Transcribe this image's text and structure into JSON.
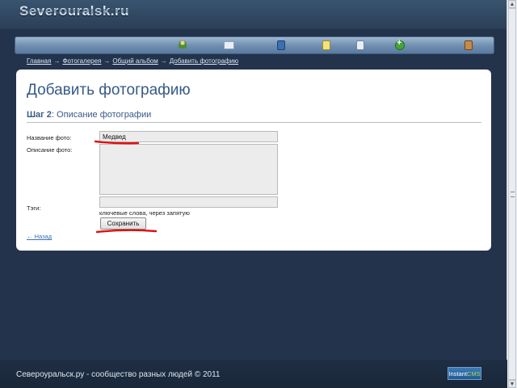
{
  "site": {
    "logo": "Severouralsk.ru"
  },
  "menu": {
    "icons": [
      "user-icon",
      "mail-icon",
      "book-icon",
      "document-icon",
      "copy-icon",
      "add-icon",
      "profile-icon"
    ]
  },
  "breadcrumb": {
    "items": [
      "Главная",
      "Фотогалерея",
      "Общий альбом",
      "Добавить фотографию"
    ],
    "separator": "→"
  },
  "page": {
    "title": "Добавить фотографию",
    "step_label": "Шаг 2",
    "step_text": ": Описание фотографии"
  },
  "form": {
    "name_label": "Название фото:",
    "name_value": "Медвед",
    "description_label": "Описание фото:",
    "description_value": "",
    "tags_label": "Тэги:",
    "tags_value": "",
    "tags_hint": "ключевые слова, через запятую",
    "save_button": "Сохранить",
    "back_link": "← Назад"
  },
  "annotations": {
    "color": "#e01010"
  },
  "footer": {
    "text": "Североуральск.ру - сообщество разных людей © 2011",
    "powered_a": "Instant",
    "powered_b": "CMS"
  },
  "colors": {
    "background": "#23334c",
    "title": "#375a87",
    "link": "#3a6fb0"
  }
}
